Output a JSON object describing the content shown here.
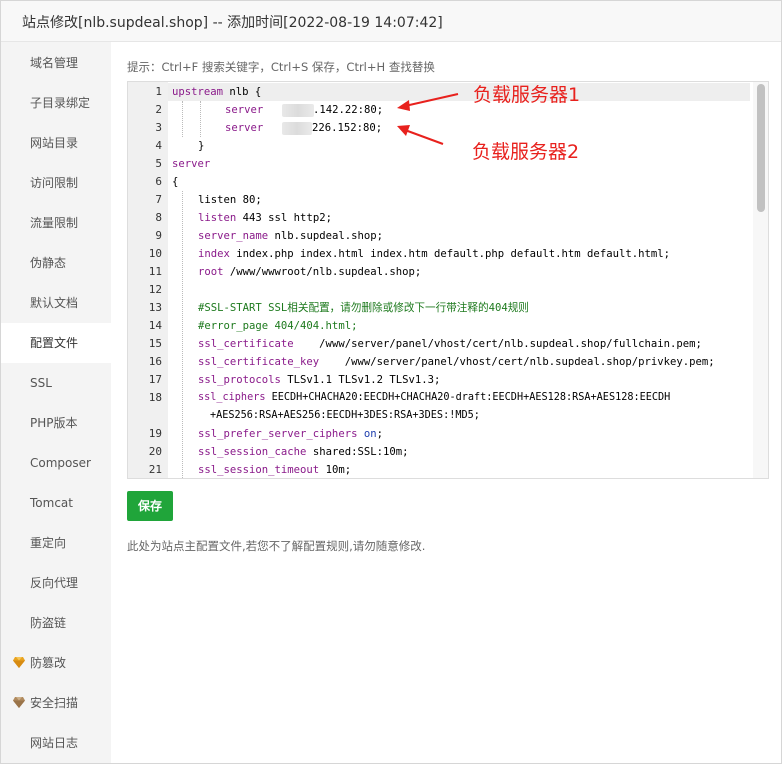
{
  "title": "站点修改[nlb.supdeal.shop] -- 添加时间[2022-08-19 14:07:42]",
  "sidebar": {
    "items": [
      {
        "label": "域名管理",
        "icon": ""
      },
      {
        "label": "子目录绑定",
        "icon": ""
      },
      {
        "label": "网站目录",
        "icon": ""
      },
      {
        "label": "访问限制",
        "icon": ""
      },
      {
        "label": "流量限制",
        "icon": ""
      },
      {
        "label": "伪静态",
        "icon": ""
      },
      {
        "label": "默认文档",
        "icon": ""
      },
      {
        "label": "配置文件",
        "icon": "",
        "active": true
      },
      {
        "label": "SSL",
        "icon": ""
      },
      {
        "label": "PHP版本",
        "icon": ""
      },
      {
        "label": "Composer",
        "icon": ""
      },
      {
        "label": "Tomcat",
        "icon": ""
      },
      {
        "label": "重定向",
        "icon": ""
      },
      {
        "label": "反向代理",
        "icon": ""
      },
      {
        "label": "防盗链",
        "icon": ""
      },
      {
        "label": "防篡改",
        "icon": "gem-icon"
      },
      {
        "label": "安全扫描",
        "icon": "gem-icon"
      },
      {
        "label": "网站日志",
        "icon": ""
      }
    ]
  },
  "hint": "提示：Ctrl+F 搜索关键字，Ctrl+S 保存，Ctrl+H 查找替换",
  "editor": {
    "line_numbers": [
      "1",
      "2",
      "3",
      "4",
      "5",
      "6",
      "7",
      "8",
      "9",
      "10",
      "11",
      "12",
      "13",
      "14",
      "15",
      "16",
      "17",
      "18",
      "",
      "19",
      "20",
      "21"
    ],
    "lines": {
      "l1_kw": "upstream",
      "l1_rest": " nlb {",
      "l2_kw": "server",
      "l2_rest": ".142.22:80;",
      "l3_kw": "server",
      "l3_rest": "226.152:80;",
      "l4": "}",
      "l5_kw": "server",
      "l6": "{",
      "l7_kw": "listen",
      "l7_rest": " 80;",
      "l8_kw": "listen",
      "l8_rest": " 443 ssl http2;",
      "l9_kw": "server_name",
      "l9_rest": " nlb.supdeal.shop;",
      "l10_kw": "index",
      "l10_rest": " index.php index.html index.htm default.php default.htm default.html;",
      "l11_kw": "root",
      "l11_rest": " /www/wwwroot/nlb.supdeal.shop;",
      "l13": "#SSL-START SSL相关配置，请勿删除或修改下一行带注释的404规则",
      "l14": "#error_page 404/404.html;",
      "l15_kw": "ssl_certificate",
      "l15_rest": "    /www/server/panel/vhost/cert/nlb.supdeal.shop/fullchain.pem;",
      "l16_kw": "ssl_certificate_key",
      "l16_rest": "    /www/server/panel/vhost/cert/nlb.supdeal.shop/privkey.pem;",
      "l17_kw": "ssl_protocols",
      "l17_rest": " TLSv1.1 TLSv1.2 TLSv1.3;",
      "l18_kw": "ssl_ciphers",
      "l18_rest": " EECDH+CHACHA20:EECDH+CHACHA20-draft:EECDH+AES128:RSA+AES128:EECDH",
      "l18b": "+AES256:RSA+AES256:EECDH+3DES:RSA+3DES:!MD5;",
      "l19_kw": "ssl_prefer_server_ciphers",
      "l19_on": " on",
      "l19_end": ";",
      "l20_kw": "ssl_session_cache",
      "l20_rest": " shared:SSL:10m;",
      "l21_kw": "ssl_session_timeout",
      "l21_rest": " 10m;"
    }
  },
  "annotations": {
    "a1": "负载服务器1",
    "a2": "负载服务器2",
    "color": "#e8211d"
  },
  "save_label": "保存",
  "note": "此处为站点主配置文件,若您不了解配置规则,请勿随意修改.",
  "colors": {
    "accent": "#20a53a",
    "keyword": "#8a1a8a",
    "comment": "#1e7a1e"
  }
}
